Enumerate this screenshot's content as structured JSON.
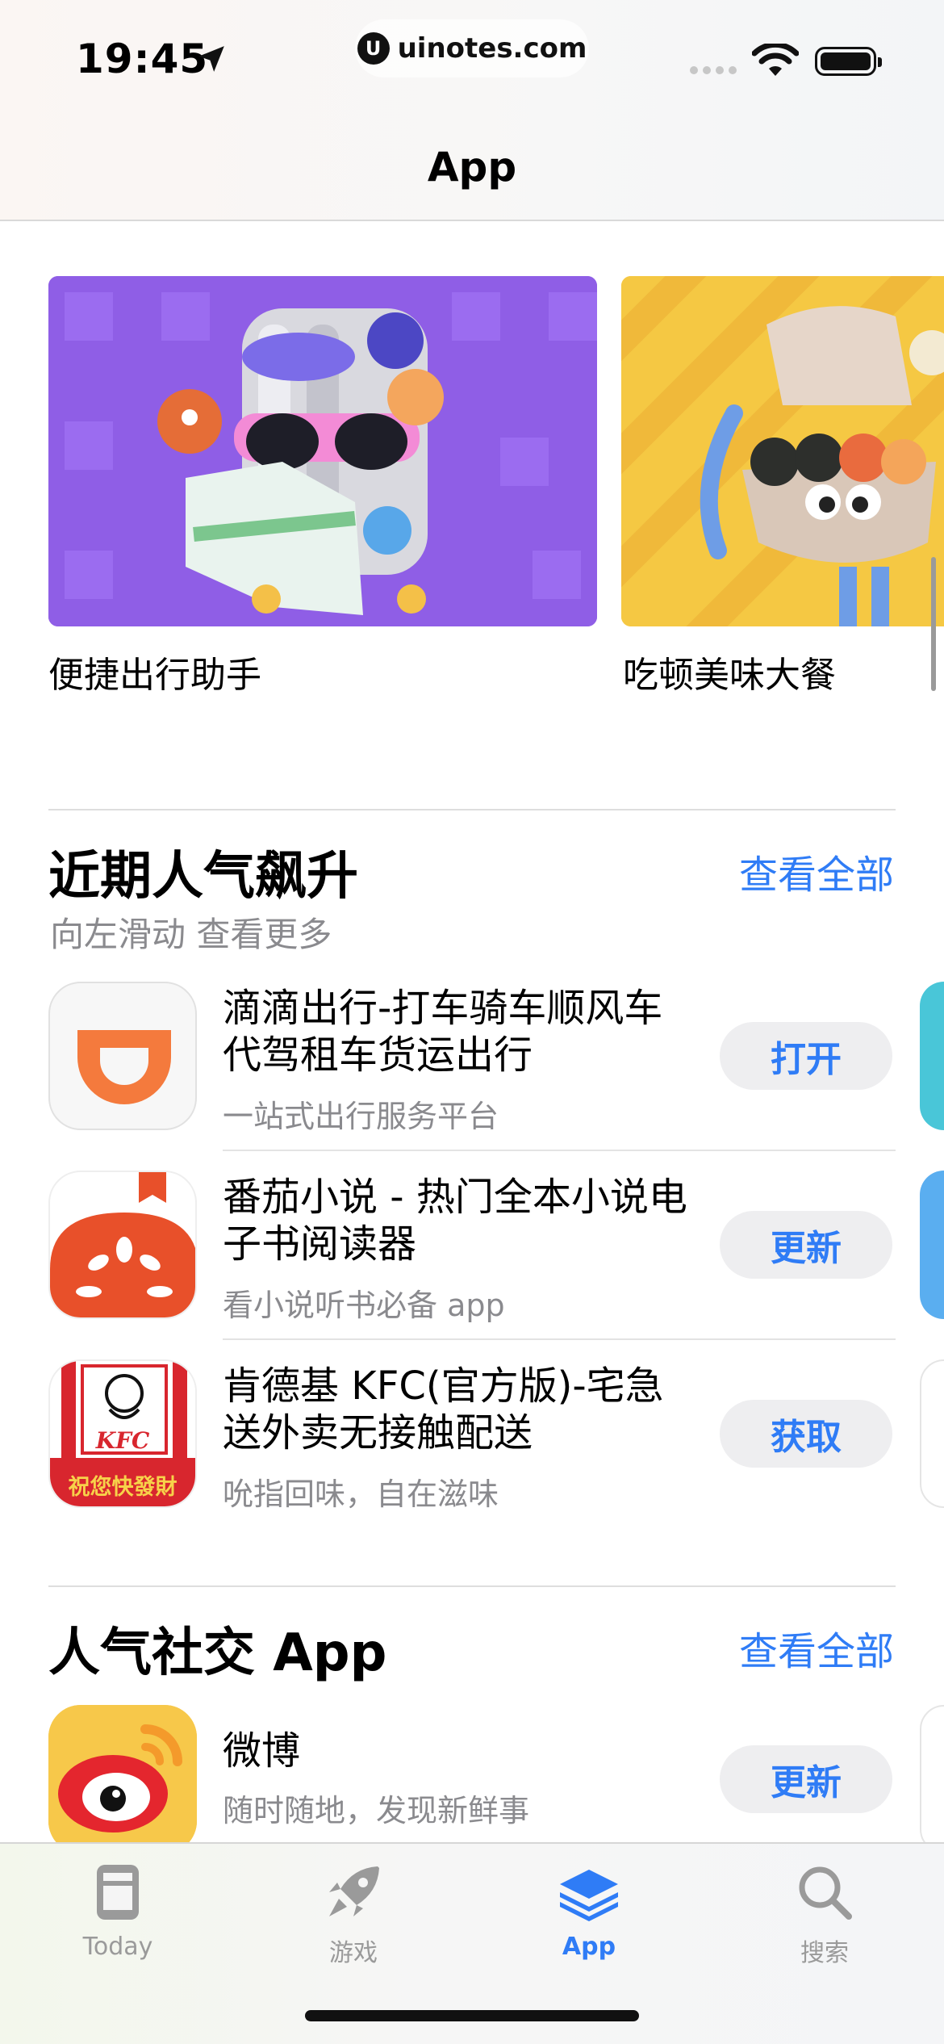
{
  "status": {
    "time": "19:45",
    "url": "uinotes.com"
  },
  "nav": {
    "title": "App"
  },
  "banners": [
    {
      "caption": "便捷出行助手"
    },
    {
      "caption": "吃顿美味大餐"
    }
  ],
  "section1": {
    "title": "近期人气飙升",
    "subtitle": "向左滑动 查看更多",
    "see_all": "查看全部",
    "apps": [
      {
        "name": "滴滴出行-打车骑车顺风车代驾租车货运出行",
        "subtitle": "一站式出行服务平台",
        "button": "打开"
      },
      {
        "name": "番茄小说 - 热门全本小说电子书阅读器",
        "subtitle": "看小说听书必备 app",
        "button": "更新"
      },
      {
        "name": "肯德基 KFC(官方版)-宅急送外卖无接触配送",
        "subtitle": "吮指回味，自在滋味",
        "button": "获取"
      }
    ]
  },
  "section2": {
    "title": "人气社交 App",
    "see_all": "查看全部",
    "apps": [
      {
        "name": "微博",
        "subtitle": "随时随地，发现新鲜事",
        "button": "更新"
      }
    ]
  },
  "kfc_icon": {
    "logo_text": "KFC",
    "slogan": "祝您快發財"
  },
  "tabs": [
    {
      "label": "Today",
      "icon": "today-icon",
      "active": false
    },
    {
      "label": "游戏",
      "icon": "rocket-icon",
      "active": false
    },
    {
      "label": "App",
      "icon": "app-stack-icon",
      "active": true
    },
    {
      "label": "搜索",
      "icon": "search-icon",
      "active": false
    }
  ],
  "colors": {
    "accent": "#2f7cf6",
    "didi_orange": "#f47a3d",
    "tomato_red": "#e8502a",
    "weibo_yellow": "#f7c84a"
  }
}
